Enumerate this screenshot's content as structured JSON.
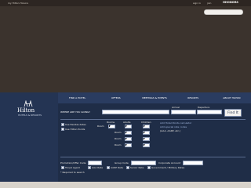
{
  "top": {
    "left_link": "my Hilton Honors",
    "right_links": [
      "sign in",
      "join"
    ],
    "brand_small": "HHONORS"
  },
  "logo": {
    "name": "Hilton",
    "sub": "HOTELS & RESORTS"
  },
  "nav": {
    "tabs": [
      "FIND A HOTEL",
      "OFFERS",
      "MEETINGS & EVENTS",
      "RESORTS",
      "ABOUT HILTON"
    ]
  },
  "search": {
    "where_label": "WHERE ARE YOU GOING?",
    "where_value": "",
    "arrival_label": "Arrival",
    "departure_label": "Departure",
    "arrival_value": "",
    "departure_value": "",
    "find_button": "Find It",
    "options": [
      "Use flexible dates",
      "Use Hilton Points"
    ],
    "col_labels": [
      "Rooms",
      "Adults",
      "Children"
    ],
    "room_label": "Room",
    "rooms": [
      {
        "n": "1",
        "adults": "1",
        "children": "0"
      },
      {
        "n": "2",
        "adults": "1",
        "children": "0"
      },
      {
        "n": "3",
        "adults": "1",
        "children": "0"
      },
      {
        "n": "4",
        "adults": "1",
        "children": "0"
      }
    ],
    "side_links": [
      "Add Hotel Points calculator",
      "Add special rate codes"
    ],
    "side_note": "(AAA, AARP, etc.)"
  },
  "rates": {
    "promo_label": "Promotion/Offer Code",
    "group_label": "Group Code",
    "corp_label": "Corporate Account",
    "checks": [
      "Travel Agent",
      "AAA Rate",
      "AARP Rate",
      "Senior Rate",
      "Government / Military Rates"
    ],
    "note": "* Required to search"
  }
}
